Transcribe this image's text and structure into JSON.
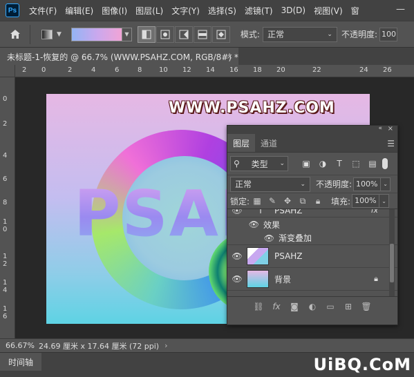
{
  "app": {
    "logo": "Ps"
  },
  "menu": [
    "文件(F)",
    "编辑(E)",
    "图像(I)",
    "图层(L)",
    "文字(Y)",
    "选择(S)",
    "滤镜(T)",
    "3D(D)",
    "视图(V)",
    "窗"
  ],
  "options": {
    "mode_label": "模式:",
    "mode_value": "正常",
    "opacity_label": "不透明度:",
    "opacity_value": "100"
  },
  "document": {
    "tab_title": "未标题-1-恢复的 @ 66.7% (WWW.PSAHZ.COM, RGB/8#) *",
    "close": "×"
  },
  "ruler": {
    "top": [
      "2",
      "0",
      "2",
      "4",
      "6",
      "8",
      "10",
      "12",
      "14",
      "16",
      "18",
      "20",
      "22",
      "24",
      "26"
    ],
    "left": [
      "0",
      "2",
      "4",
      "6",
      "8",
      "1\n0",
      "1\n2",
      "1\n4",
      "1\n6"
    ]
  },
  "canvas": {
    "watermark": "WWW.PSAHZ.COM",
    "big_text": "PSAHZ",
    "colors": {
      "bg_top": "#e6b8e4",
      "bg_bottom": "#5ed3e4"
    }
  },
  "status": {
    "zoom": "66.67%",
    "doc_size": "24.69 厘米 x 17.64 厘米 (72 ppi)",
    "arrow": "›"
  },
  "timeline": {
    "tab": "时间轴"
  },
  "brand": "UiBQ.CoM",
  "layers_panel": {
    "tabs": [
      "图层",
      "通道"
    ],
    "filter_value": "类型",
    "blend_value": "正常",
    "opacity_label": "不透明度:",
    "opacity_value": "100%",
    "lock_label": "锁定:",
    "fill_label": "填充:",
    "fill_value": "100%",
    "layers": [
      {
        "name": "PSAHZ",
        "type": "text",
        "fx": "fx"
      },
      {
        "name": "效果",
        "type": "effect-group"
      },
      {
        "name": "渐变叠加",
        "type": "effect"
      },
      {
        "name": "PSAHZ",
        "type": "smart-object"
      },
      {
        "name": "背景",
        "type": "background"
      }
    ]
  }
}
